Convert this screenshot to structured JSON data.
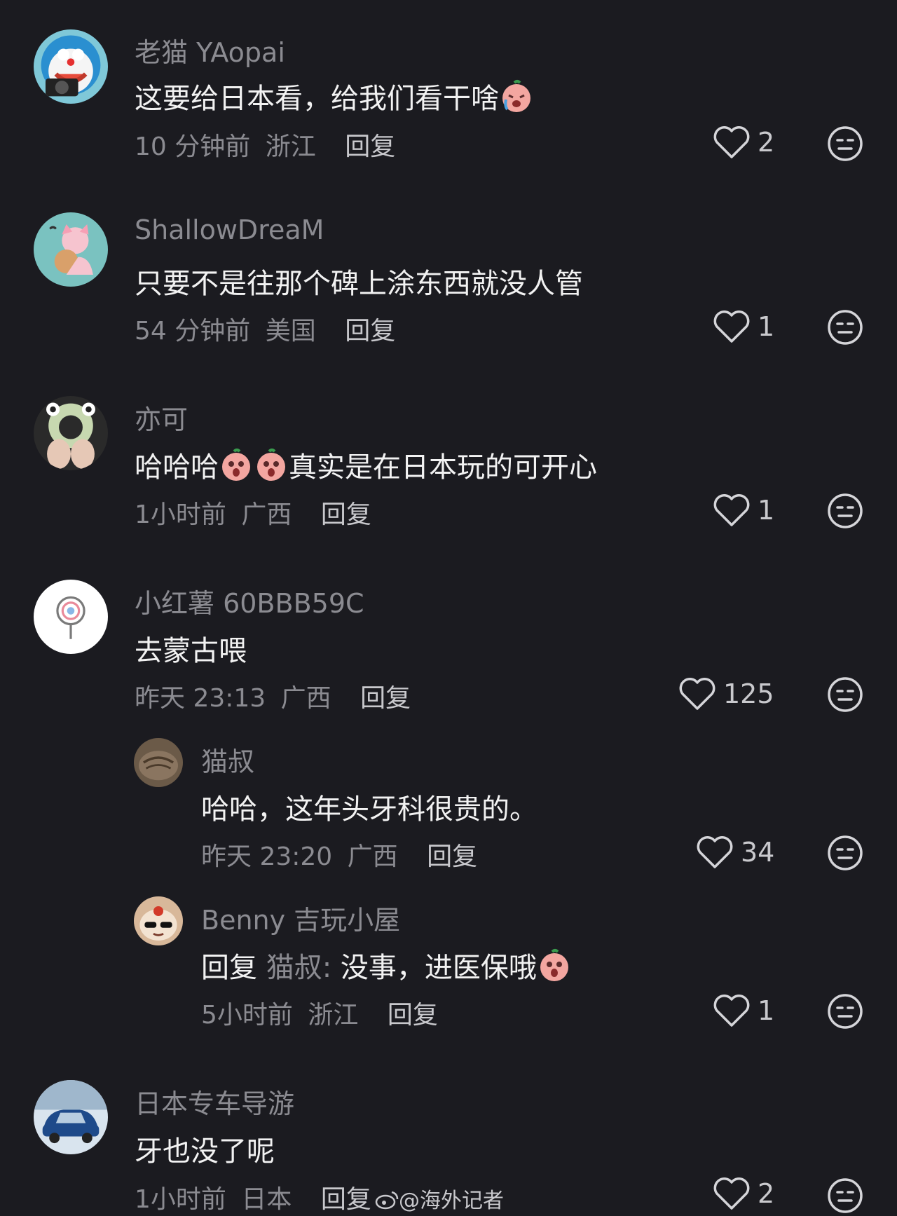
{
  "comments": [
    {
      "name": "老猫 YAopai",
      "text": "这要给日本看，给我们看干啥",
      "time": "10 分钟前",
      "location": "浙江",
      "reply": "回复",
      "likes": "2"
    },
    {
      "name": "ShallowDreaM",
      "text": "只要不是往那个碑上涂东西就没人管",
      "time": "54 分钟前",
      "location": "美国",
      "reply": "回复",
      "likes": "1"
    },
    {
      "name": "亦可",
      "text_a": "哈哈哈",
      "text_b": "真实是在日本玩的可开心",
      "time": "1小时前",
      "location": "广西",
      "reply": "回复",
      "likes": "1"
    },
    {
      "name": "小红薯 60BBB59C",
      "text": "去蒙古喂",
      "time": "昨天 23:13",
      "location": "广西",
      "reply": "回复",
      "likes": "125"
    },
    {
      "name": "猫叔",
      "text": "哈哈，这年头牙科很贵的。",
      "time": "昨天 23:20",
      "location": "广西",
      "reply": "回复",
      "likes": "34"
    },
    {
      "name": "Benny 吉玩小屋",
      "reply_prefix": "回复",
      "reply_to": "猫叔:",
      "text": "没事，进医保哦",
      "time": "5小时前",
      "location": "浙江",
      "reply": "回复",
      "likes": "1"
    },
    {
      "name": "日本专车导游",
      "text": "牙也没了呢",
      "time": "1小时前",
      "location": "日本",
      "reply": "回复",
      "likes": "2"
    }
  ],
  "watermark": "@海外记者",
  "icons": {
    "like": "heart-outline-icon",
    "react": "meh-face-icon"
  }
}
